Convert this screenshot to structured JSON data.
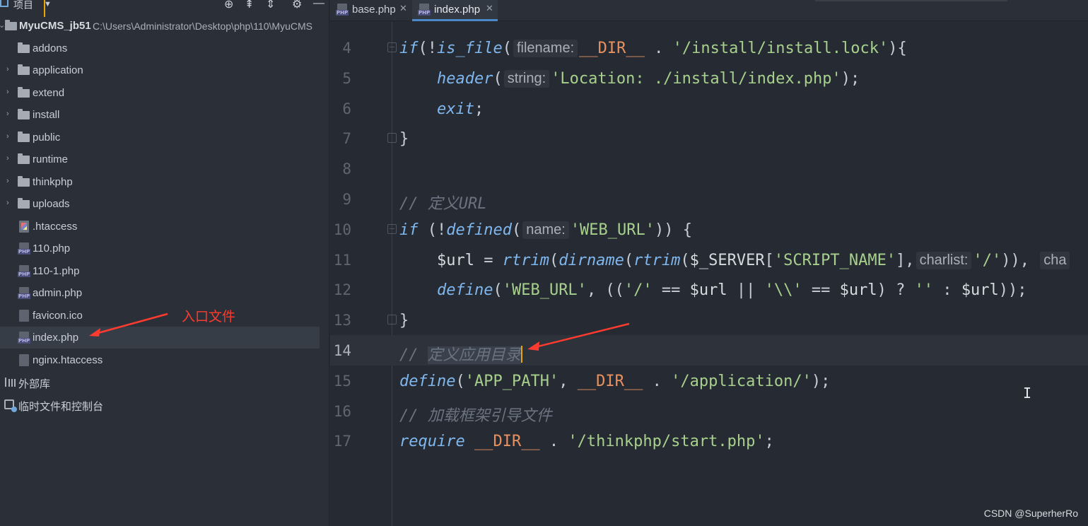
{
  "project_panel": {
    "title": "项目",
    "toolbar": [
      "crosshair-icon",
      "collapse-all-icon",
      "expand-all-icon",
      "gear-icon",
      "minimize-icon"
    ]
  },
  "tree": {
    "root_name": "MyuCMS_jb51",
    "root_path": "C:\\Users\\Administrator\\Desktop\\php\\110\\MyuCMS",
    "items": [
      {
        "label": "addons",
        "type": "folder",
        "expandable": false
      },
      {
        "label": "application",
        "type": "folder",
        "expandable": true
      },
      {
        "label": "extend",
        "type": "folder",
        "expandable": true
      },
      {
        "label": "install",
        "type": "folder",
        "expandable": true
      },
      {
        "label": "public",
        "type": "folder",
        "expandable": true
      },
      {
        "label": "runtime",
        "type": "folder",
        "expandable": true
      },
      {
        "label": "thinkphp",
        "type": "folder",
        "expandable": true
      },
      {
        "label": "uploads",
        "type": "folder",
        "expandable": true
      },
      {
        "label": ".htaccess",
        "type": "file-htaccess"
      },
      {
        "label": "110.php",
        "type": "file-php"
      },
      {
        "label": "110-1.php",
        "type": "file-php"
      },
      {
        "label": "admin.php",
        "type": "file-php"
      },
      {
        "label": "favicon.ico",
        "type": "file"
      },
      {
        "label": "index.php",
        "type": "file-php",
        "selected": true
      },
      {
        "label": "nginx.htaccess",
        "type": "file"
      }
    ],
    "external_libs": "外部库",
    "scratches": "临时文件和控制台"
  },
  "annotation_left": "入口文件",
  "tabs": [
    {
      "label": "base.php",
      "active": false
    },
    {
      "label": "index.php",
      "active": true
    }
  ],
  "editor": {
    "current_line": 14,
    "lines": [
      {
        "n": "4",
        "parts": [
          [
            "kw",
            "if"
          ],
          [
            "",
            "(!"
          ],
          [
            "fn",
            "is_file"
          ],
          [
            "",
            "("
          ],
          [
            "hint",
            "filename:"
          ],
          [
            "const",
            "__DIR__"
          ],
          [
            "",
            " . "
          ],
          [
            "str",
            "'/install/install.lock'"
          ],
          [
            "",
            "){"
          ]
        ],
        "fold": "open"
      },
      {
        "n": "5",
        "parts": [
          [
            "",
            "    "
          ],
          [
            "fn",
            "header"
          ],
          [
            "",
            "("
          ],
          [
            "hint",
            "string:"
          ],
          [
            "str",
            "'Location: ./install/index.php'"
          ],
          [
            "",
            ");"
          ]
        ]
      },
      {
        "n": "6",
        "parts": [
          [
            "",
            "    "
          ],
          [
            "kw",
            "exit"
          ],
          [
            "",
            ";"
          ]
        ]
      },
      {
        "n": "7",
        "parts": [
          [
            "",
            "}"
          ]
        ],
        "fold": "close"
      },
      {
        "n": "8",
        "parts": []
      },
      {
        "n": "9",
        "parts": [
          [
            "cmt",
            "// 定义URL"
          ]
        ]
      },
      {
        "n": "10",
        "parts": [
          [
            "kw",
            "if"
          ],
          [
            "",
            " (!"
          ],
          [
            "fn",
            "defined"
          ],
          [
            "",
            "("
          ],
          [
            "hint",
            "name:"
          ],
          [
            "str",
            "'WEB_URL'"
          ],
          [
            "",
            ")) {"
          ]
        ],
        "fold": "open"
      },
      {
        "n": "11",
        "parts": [
          [
            "",
            "    "
          ],
          [
            "var",
            "$url"
          ],
          [
            "",
            " = "
          ],
          [
            "fn",
            "rtrim"
          ],
          [
            "",
            "("
          ],
          [
            "fn",
            "dirname"
          ],
          [
            "",
            "("
          ],
          [
            "fn",
            "rtrim"
          ],
          [
            "",
            "("
          ],
          [
            "var",
            "$_SERVER"
          ],
          [
            "",
            "["
          ],
          [
            "str",
            "'SCRIPT_NAME'"
          ],
          [
            "",
            "],"
          ],
          [
            "hint",
            "charlist:"
          ],
          [
            "str",
            "'/'"
          ],
          [
            "",
            "))"
          ],
          [
            "",
            ", "
          ],
          [
            "hint",
            "cha"
          ]
        ]
      },
      {
        "n": "12",
        "parts": [
          [
            "",
            "    "
          ],
          [
            "fn",
            "define"
          ],
          [
            "",
            "("
          ],
          [
            "str",
            "'WEB_URL'"
          ],
          [
            "",
            ", (("
          ],
          [
            "str",
            "'/'"
          ],
          [
            "",
            " == "
          ],
          [
            "var",
            "$url"
          ],
          [
            "",
            " || "
          ],
          [
            "str",
            "'\\\\'"
          ],
          [
            "",
            " == "
          ],
          [
            "var",
            "$url"
          ],
          [
            "",
            ") ? "
          ],
          [
            "str",
            "''"
          ],
          [
            "",
            " : "
          ],
          [
            "var",
            "$url"
          ],
          [
            "",
            "));"
          ]
        ]
      },
      {
        "n": "13",
        "parts": [
          [
            "",
            "}"
          ]
        ],
        "fold": "close"
      },
      {
        "n": "14",
        "parts": [
          [
            "cmt",
            "// "
          ],
          [
            "cmt sel",
            "定义应用目录"
          ],
          [
            "caret",
            ""
          ]
        ]
      },
      {
        "n": "15",
        "parts": [
          [
            "fn",
            "define"
          ],
          [
            "",
            "("
          ],
          [
            "str",
            "'APP_PATH'"
          ],
          [
            "",
            ", "
          ],
          [
            "const",
            "__DIR__"
          ],
          [
            "",
            " . "
          ],
          [
            "str",
            "'/application/'"
          ],
          [
            "",
            ");"
          ]
        ]
      },
      {
        "n": "16",
        "parts": [
          [
            "cmt",
            "// 加载框架引导文件"
          ]
        ]
      },
      {
        "n": "17",
        "parts": [
          [
            "kw",
            "require"
          ],
          [
            "",
            " "
          ],
          [
            "const",
            "__DIR__"
          ],
          [
            "",
            " . "
          ],
          [
            "str",
            "'/thinkphp/start.php'"
          ],
          [
            "",
            ";"
          ]
        ]
      }
    ]
  },
  "watermark": "CSDN @SuperherRo",
  "colors": {
    "accent": "#4a88c7",
    "annotation_red": "#ff3b2f",
    "background": "#262b33"
  }
}
